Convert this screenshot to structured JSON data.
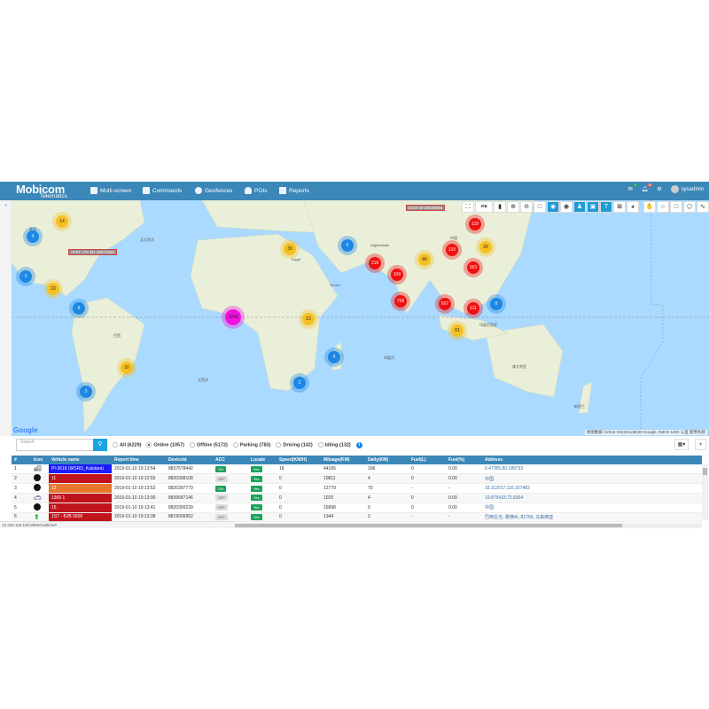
{
  "header": {
    "logo": "Mobicom",
    "logo_sub": "Telematics",
    "nav": [
      {
        "label": "Multi-screen"
      },
      {
        "label": "Commands"
      },
      {
        "label": "Geofences"
      },
      {
        "label": "POIs"
      },
      {
        "label": "Reports"
      }
    ],
    "mail_badge": "0",
    "alert_badge": "36",
    "user": "sysadmin"
  },
  "map": {
    "clusters": [
      "14",
      "4",
      "3",
      "33",
      "8",
      "3244",
      "10",
      "3",
      "35",
      "6",
      "13",
      "4",
      "2",
      "110",
      "29",
      "110",
      "86",
      "216",
      "100",
      "263",
      "758",
      "507",
      "111",
      "8",
      "61"
    ],
    "tags": [
      "AT&T LTE M1 30074526",
      "0102-30-30038956"
    ],
    "labels": [
      "北大西洋",
      "大西洋",
      "印度洋",
      "美国",
      "巴西",
      "Egypt",
      "Afghanistan",
      "中国",
      "Yemen",
      "澳大利亚",
      "新西兰",
      "印度尼西亚"
    ],
    "google": "Google",
    "attribution": "地图数据 ©2019 GS(2011)6020 Google, INEGI   1000 公里   使用条款"
  },
  "filters": {
    "search_placeholder": "Search",
    "options": [
      "All (6229)",
      "Online (1057)",
      "Offline (5172)",
      "Parking (783)",
      "Driving (142)",
      "Idling (132)"
    ],
    "selected": 1
  },
  "table": {
    "headers": [
      "#",
      "Icon",
      "Vehicle name",
      "Report time",
      "DeviceId",
      "ACC",
      "Locate",
      "Speed(KM/H)",
      "Mileage(KM)",
      "Daily(KM)",
      "Fuel(L)",
      "Fuel(%)",
      "Address"
    ],
    "rows": [
      {
        "n": "1",
        "name": "PI-3618 (WSRD_Kalutara)",
        "color": "#1a1aff",
        "time": "2019-01-10 19:13:54",
        "dev": "8837678442",
        "acc": "ON",
        "loc": "Yes",
        "speed": "18",
        "mileage": "44165",
        "daily": "106",
        "fuel": "0",
        "fuelp": "0.00",
        "addr": "6.47355,80.189733"
      },
      {
        "n": "2",
        "name": "11",
        "color": "#c0141c",
        "time": "2019-01-10 19:12:55",
        "dev": "8820398108",
        "acc": "OFF",
        "loc": "Yes",
        "speed": "0",
        "mileage": "10811",
        "daily": "4",
        "fuel": "0",
        "fuelp": "0.00",
        "addr": "中国"
      },
      {
        "n": "3",
        "name": "13",
        "color": "#e8762b",
        "time": "2019-01-10 19:13:52",
        "dev": "8820397779",
        "acc": "ON",
        "loc": "Yes",
        "speed": "0",
        "mileage": "12779",
        "daily": "79",
        "fuel": "-",
        "fuelp": "-",
        "addr": "33.112017,116.157483"
      },
      {
        "n": "4",
        "name": "1365 1",
        "color": "#c0141c",
        "time": "2019-01-10 19:13:00",
        "dev": "8839587146",
        "acc": "OFF",
        "loc": "Yes",
        "speed": "0",
        "mileage": "1025",
        "daily": "4",
        "fuel": "0",
        "fuelp": "0.00",
        "addr": "19.875433,73.8304"
      },
      {
        "n": "5",
        "name": "15",
        "color": "#c0141c",
        "time": "2019-01-10 19:13:41",
        "dev": "8820399239",
        "acc": "OFF",
        "loc": "Yes",
        "speed": "0",
        "mileage": "15898",
        "daily": "0",
        "fuel": "0",
        "fuelp": "0.00",
        "addr": "中国"
      },
      {
        "n": "6",
        "name": "1ST - BJB 5606",
        "color": "#c0141c",
        "time": "2019-01-10 19:13:38",
        "dev": "8819006952",
        "acc": "OFF",
        "loc": "Yes",
        "speed": "0",
        "mileage": "1344",
        "daily": "2",
        "fuel": "-",
        "fuelp": "-",
        "addr": "巴西古当, 柔佛州, 81700, 马来西亚"
      }
    ]
  },
  "status_url": "13.228.118.160:8082/realtime#"
}
